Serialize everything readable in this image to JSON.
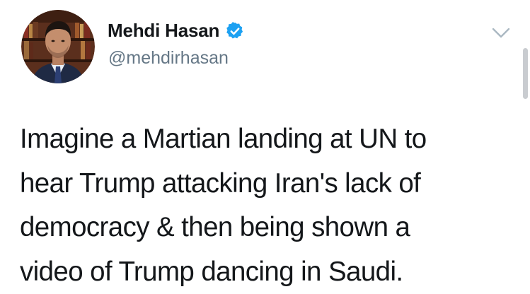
{
  "author": {
    "display_name": "Mehdi Hasan",
    "handle": "@mehdirhasan",
    "verified": true,
    "verified_icon": "verified-badge-icon",
    "avatar_icon": "profile-photo"
  },
  "menu": {
    "icon": "chevron-down-icon"
  },
  "tweet": {
    "text": "Imagine a Martian landing at UN to\nhear Trump attacking Iran's lack of\ndemocracy & then being shown a\nvideo of Trump dancing in Saudi."
  },
  "colors": {
    "text": "#14171a",
    "secondary": "#657786",
    "verified_blue": "#1da1f2",
    "caret": "#aab8c2"
  }
}
